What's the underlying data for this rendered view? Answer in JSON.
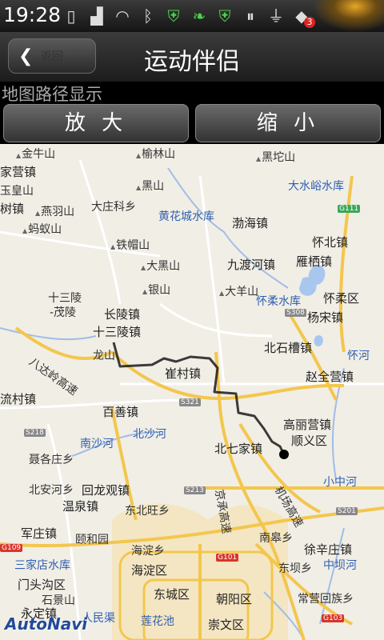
{
  "statusbar": {
    "time": "19:28",
    "notification_count": "3"
  },
  "titlebar": {
    "back_label": "返回",
    "title": "运动伴侣"
  },
  "section": {
    "label": "地图路径显示",
    "zoom_in_label": "放 大",
    "zoom_out_label": "缩 小"
  },
  "map": {
    "provider_logo": "AutoNavi",
    "labels": [
      {
        "text": "金牛山",
        "cls": "hill"
      },
      {
        "text": "榆林山",
        "cls": "hill"
      },
      {
        "text": "黑坨山",
        "cls": "hill"
      },
      {
        "text": "家营镇",
        "cls": "big"
      },
      {
        "text": "玉皇山",
        "cls": ""
      },
      {
        "text": "黑山",
        "cls": "hill"
      },
      {
        "text": "大水峪水库",
        "cls": "water"
      },
      {
        "text": "大庄科乡",
        "cls": ""
      },
      {
        "text": "黄花城水库",
        "cls": "water"
      },
      {
        "text": "树镇",
        "cls": "big"
      },
      {
        "text": "燕羽山",
        "cls": "hill"
      },
      {
        "text": "渤海镇",
        "cls": "big"
      },
      {
        "text": "蚂蚁山",
        "cls": "hill"
      },
      {
        "text": "铁帽山",
        "cls": "hill"
      },
      {
        "text": "怀北镇",
        "cls": "big"
      },
      {
        "text": "大黑山",
        "cls": "hill"
      },
      {
        "text": "九渡河镇",
        "cls": "big"
      },
      {
        "text": "雁栖镇",
        "cls": "big"
      },
      {
        "text": "银山",
        "cls": "hill"
      },
      {
        "text": "大羊山",
        "cls": "hill"
      },
      {
        "text": "十三陵",
        "cls": ""
      },
      {
        "text": "-茂陵",
        "cls": ""
      },
      {
        "text": "怀柔水库",
        "cls": "water"
      },
      {
        "text": "怀柔区",
        "cls": "big"
      },
      {
        "text": "长陵镇",
        "cls": "big"
      },
      {
        "text": "杨宋镇",
        "cls": "big"
      },
      {
        "text": "十三陵镇",
        "cls": "big"
      },
      {
        "text": "八达岭高速",
        "cls": ""
      },
      {
        "text": "龙山",
        "cls": ""
      },
      {
        "text": "北石槽镇",
        "cls": "big"
      },
      {
        "text": "怀河",
        "cls": "water"
      },
      {
        "text": "崔村镇",
        "cls": "big"
      },
      {
        "text": "赵全营镇",
        "cls": "big"
      },
      {
        "text": "流村镇",
        "cls": "big"
      },
      {
        "text": "百善镇",
        "cls": "big"
      },
      {
        "text": "高丽营镇",
        "cls": "big"
      },
      {
        "text": "北沙河",
        "cls": "water"
      },
      {
        "text": "顺义区",
        "cls": "big"
      },
      {
        "text": "南沙河",
        "cls": "water"
      },
      {
        "text": "北七家镇",
        "cls": "big"
      },
      {
        "text": "聂各庄乡",
        "cls": ""
      },
      {
        "text": "小中河",
        "cls": "water"
      },
      {
        "text": "北安河乡",
        "cls": ""
      },
      {
        "text": "回龙观镇",
        "cls": "big"
      },
      {
        "text": "机场高速",
        "cls": ""
      },
      {
        "text": "京承高速",
        "cls": ""
      },
      {
        "text": "温泉镇",
        "cls": "big"
      },
      {
        "text": "东北旺乡",
        "cls": ""
      },
      {
        "text": "军庄镇",
        "cls": "big"
      },
      {
        "text": "颐和园",
        "cls": ""
      },
      {
        "text": "南皋乡",
        "cls": ""
      },
      {
        "text": "海淀乡",
        "cls": ""
      },
      {
        "text": "徐辛庄镇",
        "cls": "big"
      },
      {
        "text": "三家店水库",
        "cls": "water"
      },
      {
        "text": "海淀区",
        "cls": "big"
      },
      {
        "text": "东坝乡",
        "cls": ""
      },
      {
        "text": "中坝河",
        "cls": "water"
      },
      {
        "text": "门头沟区",
        "cls": "big"
      },
      {
        "text": "石景山",
        "cls": ""
      },
      {
        "text": "东城区",
        "cls": "big"
      },
      {
        "text": "朝阳区",
        "cls": "big"
      },
      {
        "text": "常营回族乡",
        "cls": ""
      },
      {
        "text": "永定镇",
        "cls": "big"
      },
      {
        "text": "人民渠",
        "cls": "water"
      },
      {
        "text": "莲花池",
        "cls": "water"
      },
      {
        "text": "崇文区",
        "cls": "big"
      }
    ],
    "road_shields": [
      "G111",
      "S308",
      "S321",
      "S218",
      "S213",
      "G109",
      "G101",
      "S201",
      "G103"
    ]
  }
}
